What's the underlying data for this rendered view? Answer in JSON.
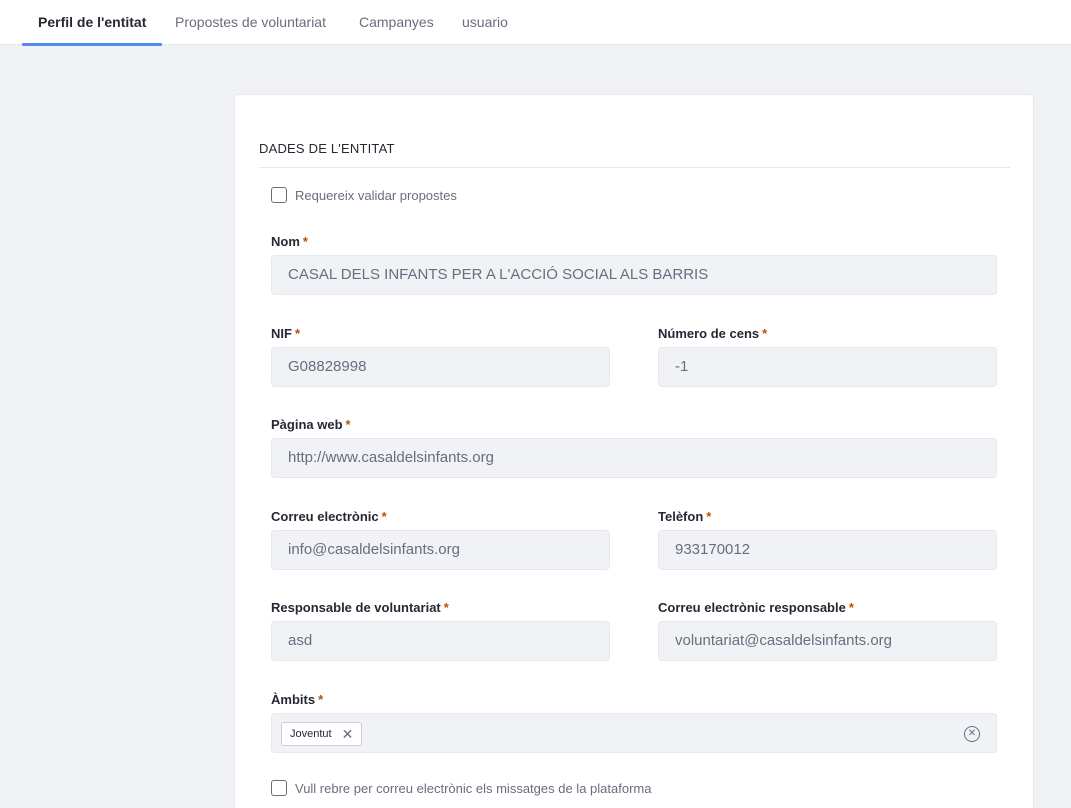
{
  "tabs": [
    {
      "label": "Perfil de l'entitat",
      "active": true
    },
    {
      "label": "Propostes de voluntariat",
      "active": false
    },
    {
      "label": "Campanyes",
      "active": false
    },
    {
      "label": "usuario",
      "active": false
    }
  ],
  "section": {
    "title": "DADES DE L'ENTITAT"
  },
  "require_validation": {
    "label": "Requereix validar propostes",
    "checked": false
  },
  "required_mark": "*",
  "fields": {
    "nom": {
      "label": "Nom",
      "value": "CASAL DELS INFANTS PER A L'ACCIÓ SOCIAL ALS BARRIS"
    },
    "nif": {
      "label": "NIF",
      "value": "G08828998"
    },
    "cens": {
      "label": "Número de cens",
      "value": "-1"
    },
    "web": {
      "label": "Pàgina web",
      "value": "http://www.casaldelsinfants.org"
    },
    "email": {
      "label": "Correu electrònic",
      "value": "info@casaldelsinfants.org"
    },
    "telefon": {
      "label": "Telèfon",
      "value": "933170012"
    },
    "responsable": {
      "label": "Responsable de voluntariat",
      "value": "asd"
    },
    "email_responsable": {
      "label": "Correu electrònic responsable",
      "value": "voluntariat@casaldelsinfants.org"
    },
    "ambits": {
      "label": "Àmbits",
      "tags": [
        "Joventut"
      ]
    }
  },
  "receive_emails": {
    "label": "Vull rebre per correu electrònic els missatges de la plataforma",
    "checked": false
  },
  "icons": {
    "tag_remove": "close-icon",
    "clear_all": "clear-circle-icon"
  },
  "colors": {
    "accent": "#528af2",
    "required": "#b95000",
    "input_bg": "#f1f2f5"
  }
}
